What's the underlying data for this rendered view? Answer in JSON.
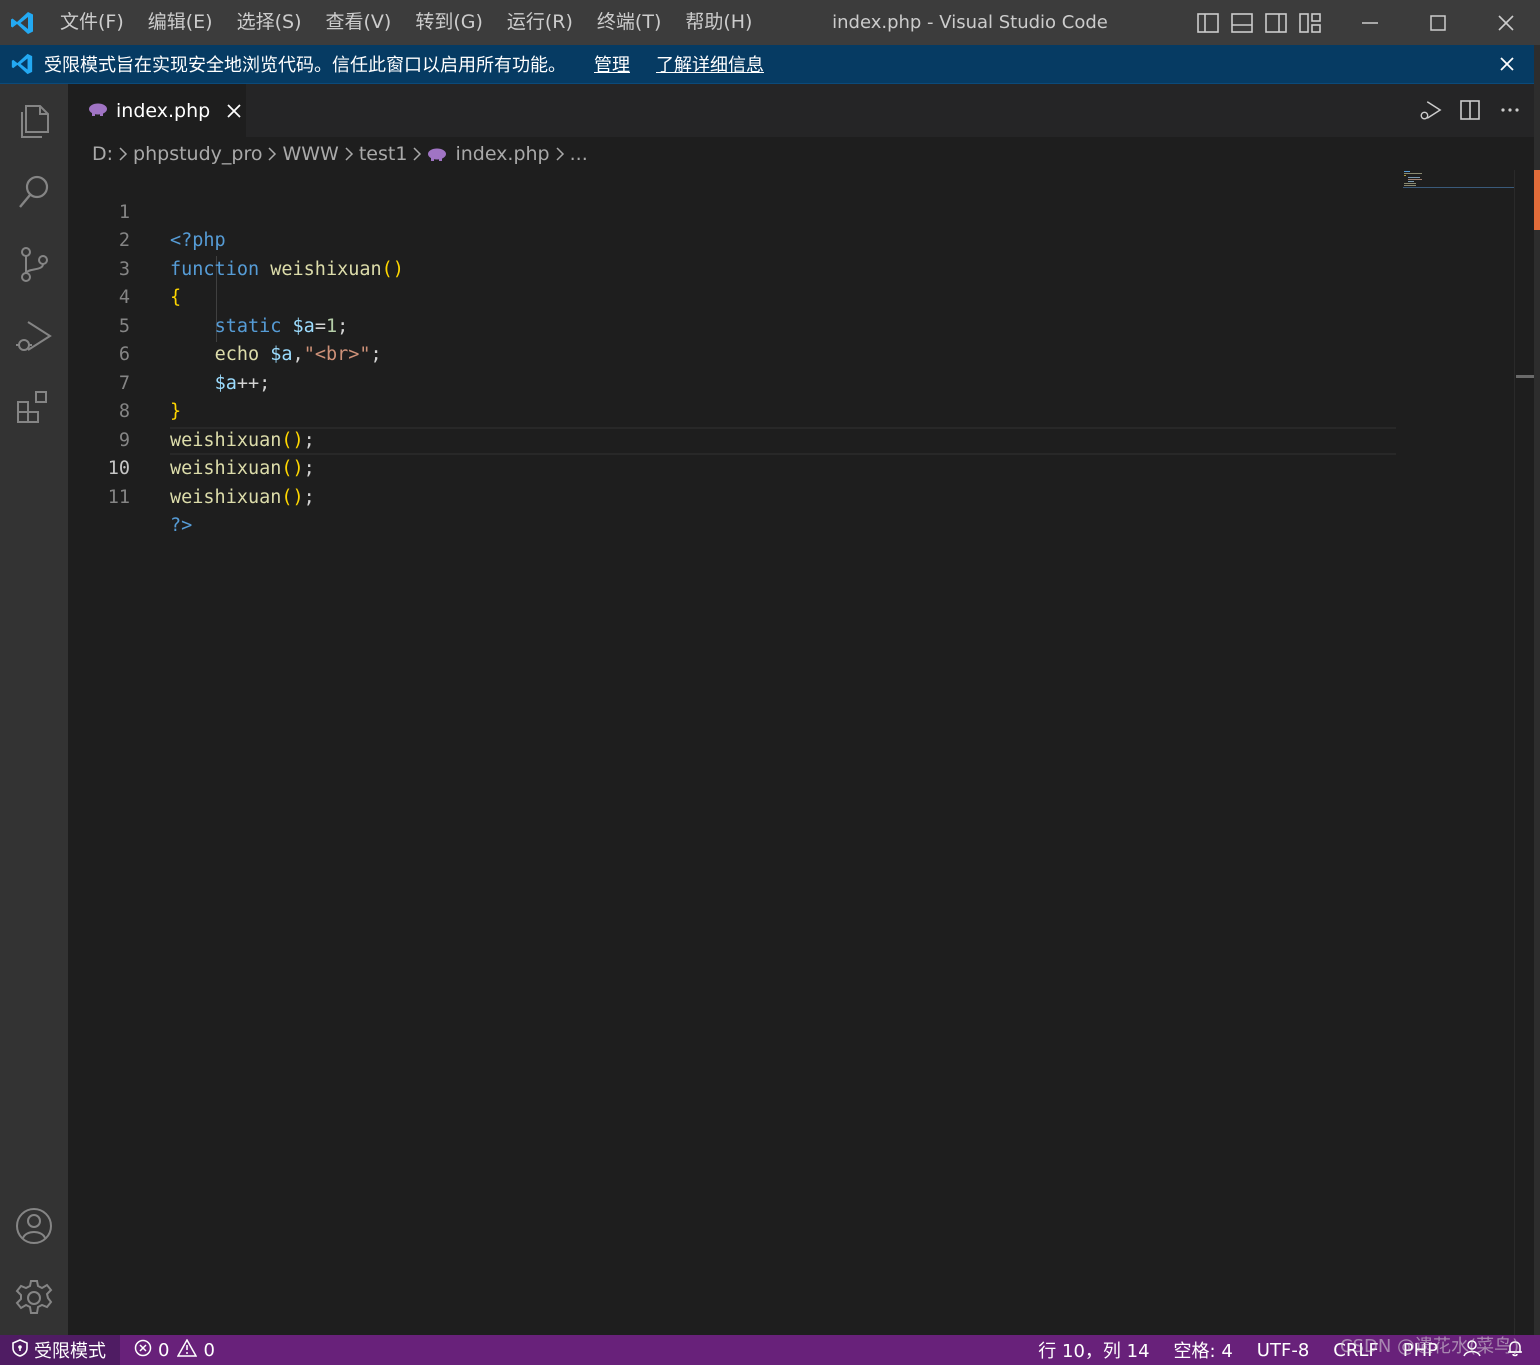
{
  "window": {
    "title": "index.php - Visual Studio Code"
  },
  "menu": {
    "items": [
      "文件(F)",
      "编辑(E)",
      "选择(S)",
      "查看(V)",
      "转到(G)",
      "运行(R)",
      "终端(T)",
      "帮助(H)"
    ]
  },
  "banner": {
    "message": "受限模式旨在实现安全地浏览代码。信任此窗口以启用所有功能。",
    "manage_link": "管理",
    "learn_more_link": "了解详细信息"
  },
  "activity_bar": {
    "icons": [
      "explorer-icon",
      "search-icon",
      "source-control-icon",
      "run-debug-icon",
      "extensions-icon",
      "account-icon",
      "settings-gear-icon"
    ]
  },
  "tab": {
    "label": "index.php"
  },
  "breadcrumb": {
    "items": [
      "D:",
      "phpstudy_pro",
      "WWW",
      "test1",
      "index.php",
      "..."
    ]
  },
  "editor": {
    "language": "php",
    "active_line": 10,
    "line_numbers": [
      "1",
      "2",
      "3",
      "4",
      "5",
      "6",
      "7",
      "8",
      "9",
      "10",
      "11"
    ],
    "lines": [
      "<?php",
      "function weishixuan()",
      "{",
      "    static $a=1;",
      "    echo $a,\"<br>\";",
      "    $a++;",
      "}",
      "weishixuan();",
      "weishixuan();",
      "weishixuan();",
      "?>"
    ]
  },
  "statusbar": {
    "restricted_mode": "受限模式",
    "errors": "0",
    "warnings": "0",
    "cursor_position": "行 10，列 14",
    "indentation": "空格: 4",
    "encoding": "UTF-8",
    "eol": "CRLF",
    "language_mode": "PHP"
  },
  "watermark": {
    "text": "CSDN @遗花水(菜鸟)"
  },
  "colors": {
    "titlebar": "#3c3c3c",
    "banner": "#063b63",
    "activitybar": "#333333",
    "editor_bg": "#1e1e1e",
    "statusbar": "#68217a",
    "accent_blue": "#007acc"
  }
}
